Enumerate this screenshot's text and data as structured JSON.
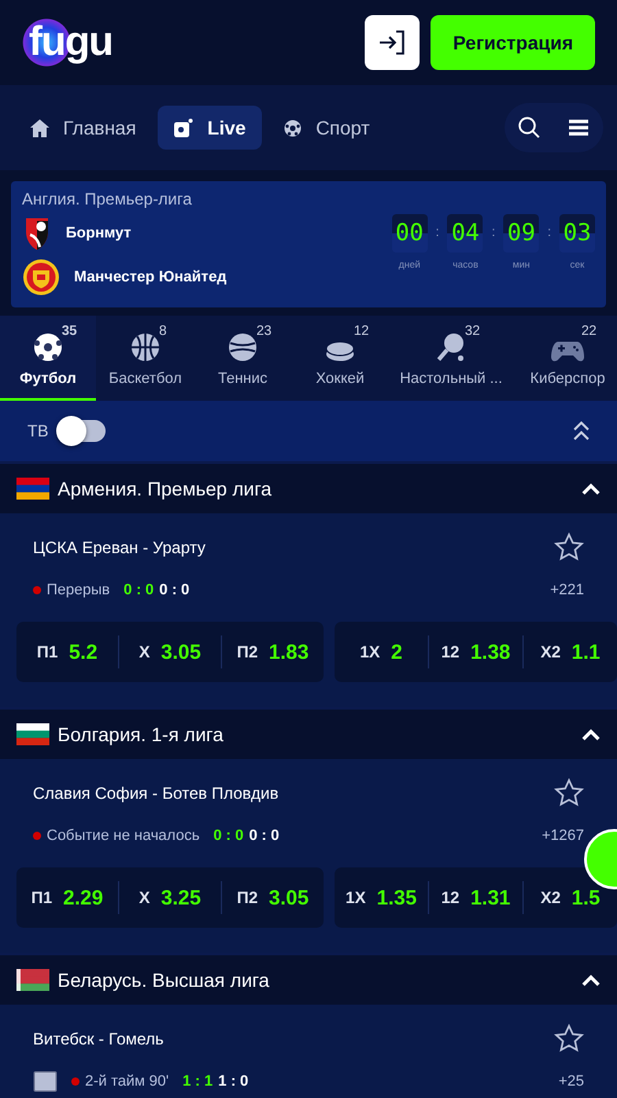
{
  "header": {
    "logo": "fugu",
    "register_button": "Регистрация"
  },
  "nav": {
    "items": [
      {
        "label": "Главная",
        "selected": false
      },
      {
        "label": "Live",
        "selected": true
      },
      {
        "label": "Спорт",
        "selected": false
      }
    ]
  },
  "featured": {
    "league": "Англия. Премьер-лига",
    "teams": [
      {
        "name": "Борнмут"
      },
      {
        "name": "Манчестер Юнайтед"
      }
    ],
    "countdown_separator": ":",
    "countdown": [
      {
        "value": "00",
        "unit": "дней"
      },
      {
        "value": "04",
        "unit": "часов"
      },
      {
        "value": "09",
        "unit": "мин"
      },
      {
        "value": "03",
        "unit": "сек"
      }
    ]
  },
  "sports": [
    {
      "label": "Футбол",
      "count": "35",
      "selected": true
    },
    {
      "label": "Баскетбол",
      "count": "8",
      "selected": false
    },
    {
      "label": "Теннис",
      "count": "23",
      "selected": false
    },
    {
      "label": "Хоккей",
      "count": "12",
      "selected": false
    },
    {
      "label": "Настольный ...",
      "count": "32",
      "selected": false
    },
    {
      "label": "Киберспор",
      "count": "22",
      "selected": false
    }
  ],
  "tv": {
    "label": "ТВ",
    "on": false
  },
  "leagues": [
    {
      "name": "Армения. Премьер лига",
      "expanded": true,
      "events": [
        {
          "title": "ЦСКА Ереван - Урарту",
          "video": false,
          "status": "Перерыв",
          "score": "0 : 0",
          "score_extra": "0 : 0",
          "more": "+221",
          "markets": [
            [
              {
                "label": "П1",
                "value": "5.2"
              },
              {
                "label": "X",
                "value": "3.05"
              },
              {
                "label": "П2",
                "value": "1.83"
              }
            ],
            [
              {
                "label": "1X",
                "value": "2"
              },
              {
                "label": "12",
                "value": "1.38"
              },
              {
                "label": "X2",
                "value": "1.1"
              }
            ]
          ]
        }
      ]
    },
    {
      "name": "Болгария. 1-я лига",
      "expanded": true,
      "events": [
        {
          "title": "Славия София - Ботев Пловдив",
          "video": false,
          "status": "Событие не началось",
          "score": "0 : 0",
          "score_extra": "0 : 0",
          "more": "+1267",
          "markets": [
            [
              {
                "label": "П1",
                "value": "2.29"
              },
              {
                "label": "X",
                "value": "3.25"
              },
              {
                "label": "П2",
                "value": "3.05"
              }
            ],
            [
              {
                "label": "1X",
                "value": "1.35"
              },
              {
                "label": "12",
                "value": "1.31"
              },
              {
                "label": "X2",
                "value": "1.5"
              }
            ]
          ]
        }
      ]
    },
    {
      "name": "Беларусь. Высшая лига",
      "expanded": true,
      "events": [
        {
          "title": "Витебск - Гомель",
          "video": true,
          "status": "2-й тайм 90'",
          "score": "1 : 1",
          "score_extra": "1 : 0",
          "more": "+25"
        }
      ]
    }
  ]
}
